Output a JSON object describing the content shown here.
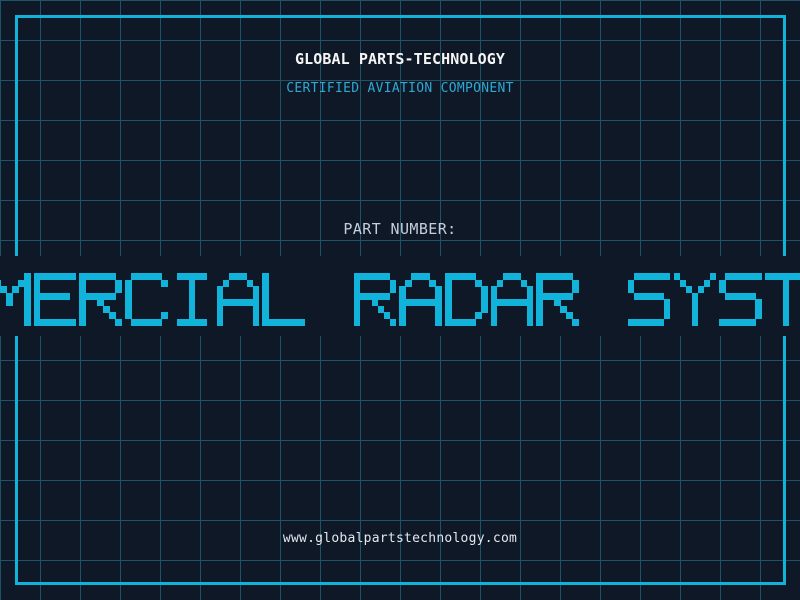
{
  "theme": {
    "background": "#0f1827",
    "grid_line": "#1d5468",
    "accent_cyan": "#12b3da",
    "subtitle_cyan": "#2da9d4",
    "title_white": "#f5f5f5",
    "label_gray": "#c5cedd",
    "url_white": "#e2e8ee"
  },
  "header": {
    "title": "GLOBAL PARTS-TECHNOLOGY",
    "subtitle": "CERTIFIED AVIATION COMPONENT"
  },
  "part": {
    "label": "PART NUMBER:",
    "marquee_visible_text": "MERCIAL RADAR SYST"
  },
  "footer": {
    "url": "www.globalpartstechnology.com"
  }
}
